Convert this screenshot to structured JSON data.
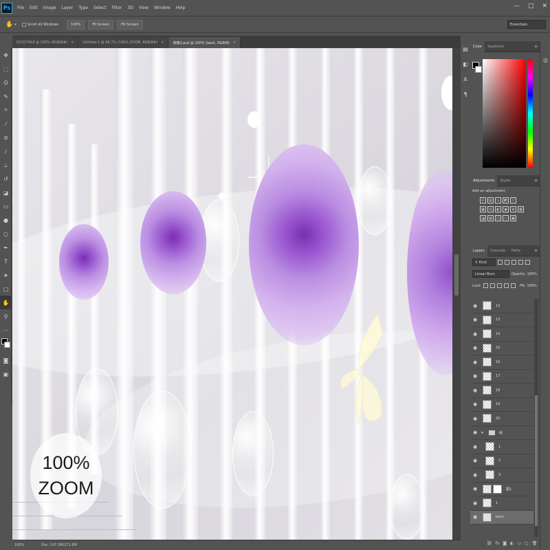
{
  "app": {
    "logo": "Ps"
  },
  "menu": [
    "File",
    "Edit",
    "Image",
    "Layer",
    "Type",
    "Select",
    "Filter",
    "3D",
    "View",
    "Window",
    "Help"
  ],
  "window_controls": [
    "—",
    "□",
    "✕"
  ],
  "options": {
    "scroll_all_windows": "Scroll All Windows",
    "btn_100": "100%",
    "fit_screen": "Fit Screen",
    "fill_screen": "Fill Screen",
    "workspace": "Essentials"
  },
  "tabs": [
    {
      "label": "DCS17418 @ 100% (RGB/8#)",
      "active": false
    },
    {
      "label": "Untitled-1 @ 66.7% (100% ZOOM, RGB/8#)",
      "active": false
    },
    {
      "label": "玫瑰3.psd @ 100% (back, RGB/8)",
      "active": true
    }
  ],
  "canvas": {
    "zoom_text_1": "100%",
    "zoom_text_2": "ZOOM"
  },
  "status": {
    "zoom": "100%",
    "doc": "Doc: 147.2M/171.6M"
  },
  "panels": {
    "color_tabs": [
      "Color",
      "Swatches"
    ],
    "adjust_tabs": [
      "Adjustments",
      "Styles"
    ],
    "adjust_label": "Add an adjustment",
    "layer_tabs": [
      "Layers",
      "Channels",
      "Paths"
    ],
    "filter_kind": "Kind",
    "blend_mode": "Linear Burn",
    "opacity_label": "Opacity:",
    "opacity_value": "100%",
    "lock_label": "Lock:",
    "fill_label": "Fill:",
    "fill_value": "100%"
  },
  "layers": [
    {
      "name": "12",
      "type": "layer",
      "selected": false
    },
    {
      "name": "13",
      "type": "layer",
      "selected": false
    },
    {
      "name": "14",
      "type": "layer",
      "selected": false
    },
    {
      "name": "15",
      "type": "layer",
      "selected": false
    },
    {
      "name": "16",
      "type": "layer",
      "selected": false
    },
    {
      "name": "17",
      "type": "layer",
      "selected": false
    },
    {
      "name": "18",
      "type": "layer",
      "selected": false
    },
    {
      "name": "19",
      "type": "layer",
      "selected": false
    },
    {
      "name": "20",
      "type": "layer",
      "selected": false
    },
    {
      "name": "组",
      "type": "group",
      "selected": false
    },
    {
      "name": "1",
      "type": "child",
      "selected": false
    },
    {
      "name": "2",
      "type": "child",
      "selected": false
    },
    {
      "name": "3",
      "type": "child",
      "selected": false
    },
    {
      "name": "图1",
      "type": "mask",
      "selected": false
    },
    {
      "name": "1",
      "type": "layer",
      "selected": false
    },
    {
      "name": "back",
      "type": "layer",
      "selected": true
    }
  ],
  "icons": {
    "eye": "visibility-eye-icon",
    "folder": "folder-icon"
  }
}
